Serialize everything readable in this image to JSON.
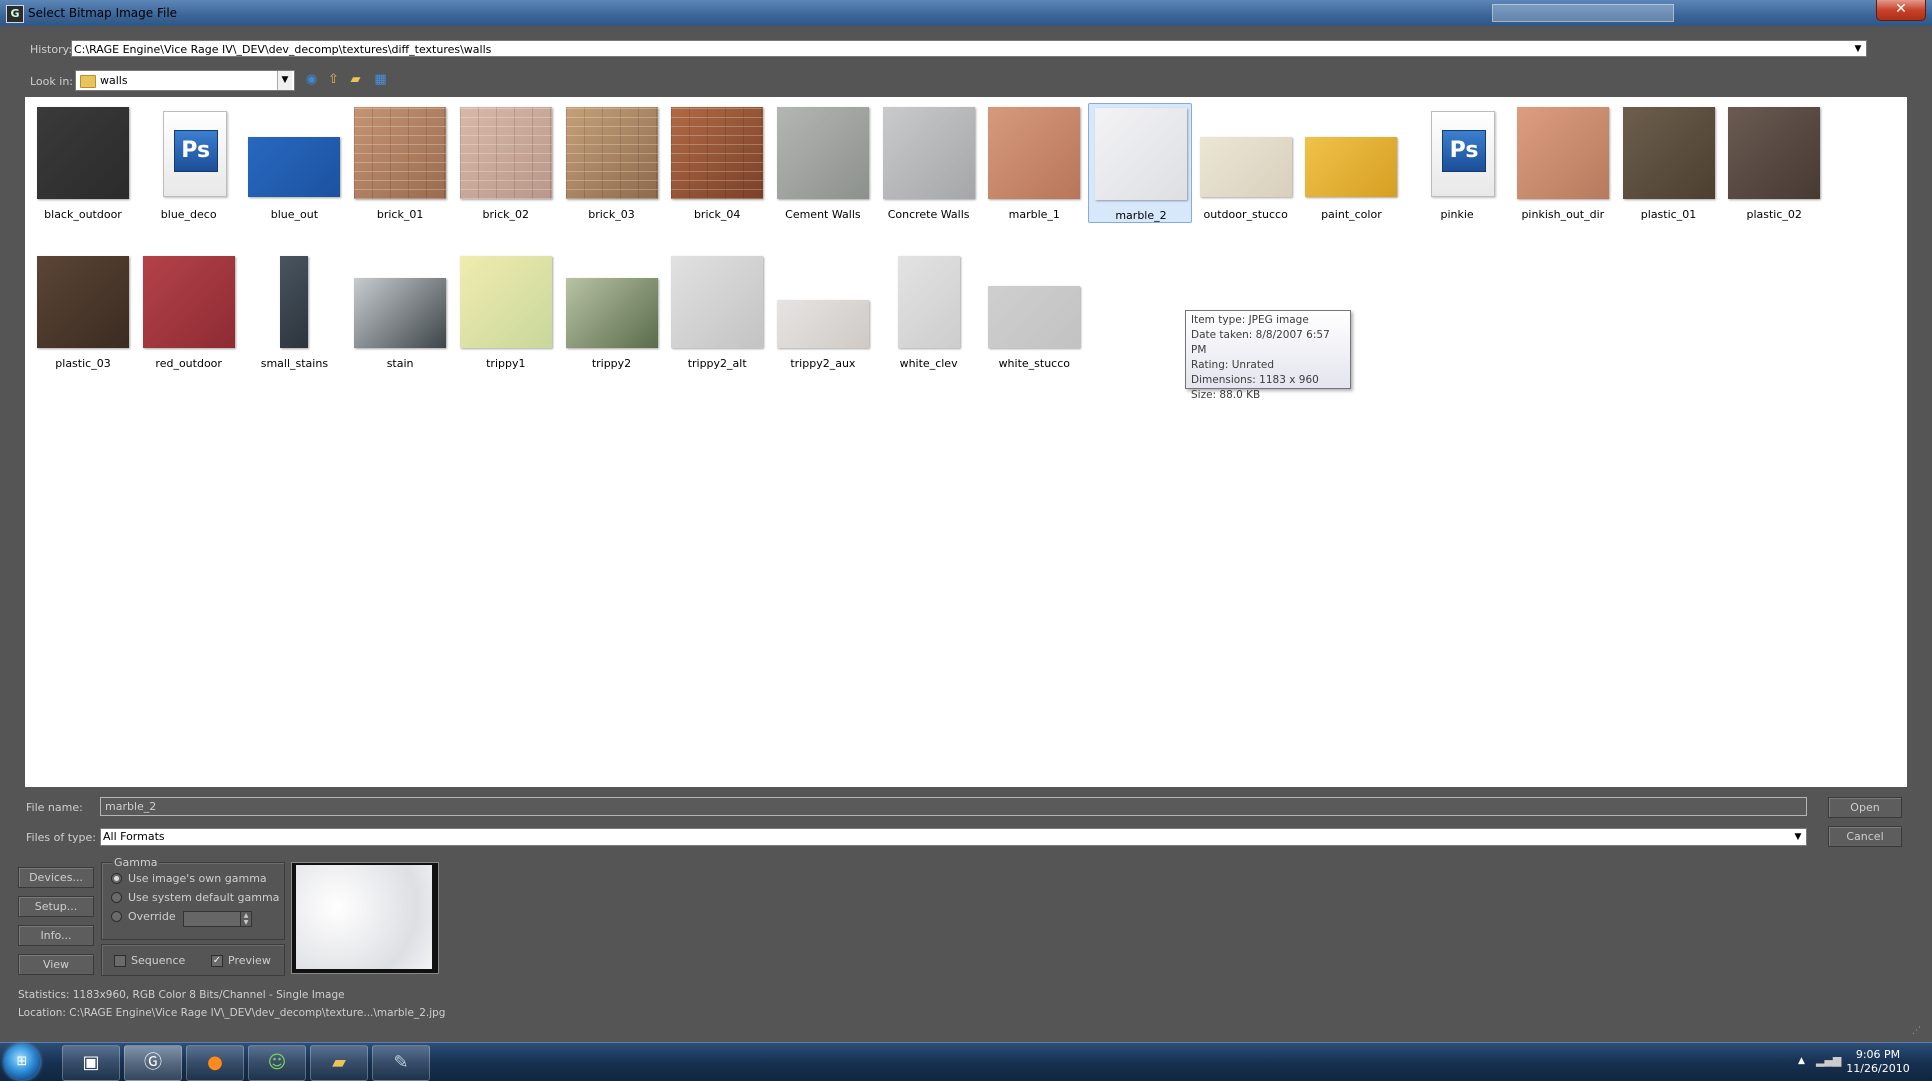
{
  "window": {
    "title": "Select Bitmap Image File"
  },
  "history": {
    "label": "History:",
    "path": "C:\\RAGE Engine\\Vice Rage IV\\_DEV\\dev_decomp\\textures\\diff_textures\\walls"
  },
  "lookin": {
    "label": "Look in:",
    "folder": "walls"
  },
  "files": [
    {
      "name": "black_outdoor",
      "kind": "img",
      "colors": [
        "#3a3a3a",
        "#2b2b2b"
      ]
    },
    {
      "name": "blue_deco",
      "kind": "ps"
    },
    {
      "name": "blue_out",
      "kind": "img",
      "colors": [
        "#2868c0",
        "#1c52a0"
      ]
    },
    {
      "name": "brick_01",
      "kind": "img",
      "colors": [
        "#c49473",
        "#9a6b4f"
      ],
      "pattern": "brick"
    },
    {
      "name": "brick_02",
      "kind": "img",
      "colors": [
        "#d8b9a8",
        "#b9978a"
      ],
      "pattern": "brick"
    },
    {
      "name": "brick_03",
      "kind": "img",
      "colors": [
        "#c5a07a",
        "#8d6a4c"
      ],
      "pattern": "brick"
    },
    {
      "name": "brick_04",
      "kind": "img",
      "colors": [
        "#b06a45",
        "#7a4128"
      ],
      "pattern": "brick"
    },
    {
      "name": "Cement Walls",
      "kind": "img",
      "colors": [
        "#b3b6b2",
        "#8d918c"
      ]
    },
    {
      "name": "Concrete Walls",
      "kind": "img",
      "colors": [
        "#c9cacb",
        "#a5a6a8"
      ]
    },
    {
      "name": "marble_1",
      "kind": "img",
      "colors": [
        "#d69a7b",
        "#b8755a"
      ]
    },
    {
      "name": "marble_2",
      "kind": "img",
      "colors": [
        "#f3f3f5",
        "#dedfe3"
      ]
    },
    {
      "name": "outdoor_stucco",
      "kind": "img",
      "colors": [
        "#ece6d6",
        "#d8d0bb"
      ]
    },
    {
      "name": "paint_color",
      "kind": "img",
      "colors": [
        "#f0c24a",
        "#d69f22"
      ]
    },
    {
      "name": "pinkie",
      "kind": "ps"
    },
    {
      "name": "pinkish_out_dir",
      "kind": "img",
      "colors": [
        "#dc9e7f",
        "#b87a5d"
      ]
    },
    {
      "name": "plastic_01",
      "kind": "img",
      "colors": [
        "#6d5e4c",
        "#4c3f31"
      ]
    },
    {
      "name": "plastic_02",
      "kind": "img",
      "colors": [
        "#6a5a52",
        "#473a33"
      ]
    },
    {
      "name": "plastic_03",
      "kind": "img",
      "colors": [
        "#5b4536",
        "#3b2b21"
      ]
    },
    {
      "name": "red_outdoor",
      "kind": "img",
      "colors": [
        "#b3424a",
        "#8f2b33"
      ]
    },
    {
      "name": "small_stains",
      "kind": "img",
      "colors": [
        "#4a5560",
        "#2c343c"
      ]
    },
    {
      "name": "stain",
      "kind": "img",
      "colors": [
        "#c7ccd0",
        "#3e4549"
      ]
    },
    {
      "name": "trippy1",
      "kind": "img",
      "colors": [
        "#f0ecb0",
        "#c9d79a"
      ]
    },
    {
      "name": "trippy2",
      "kind": "img",
      "colors": [
        "#b9c2a4",
        "#596c4c"
      ]
    },
    {
      "name": "trippy2_alt",
      "kind": "img",
      "colors": [
        "#e1e1e1",
        "#c3c3c3"
      ]
    },
    {
      "name": "trippy2_aux",
      "kind": "img",
      "colors": [
        "#e6e4e2",
        "#cfcac6"
      ]
    },
    {
      "name": "white_clev",
      "kind": "img",
      "colors": [
        "#e3e3e3",
        "#cdcdcd"
      ]
    },
    {
      "name": "white_stucco",
      "kind": "img",
      "colors": [
        "#cfcfcf",
        "#c2c2c2"
      ]
    }
  ],
  "tooltip": {
    "item_type": "Item type: JPEG image",
    "date_taken": "Date taken: 8/8/2007 6:57 PM",
    "rating": "Rating: Unrated",
    "dimensions": "Dimensions: 1183 x 960",
    "size": "Size: 88.0 KB"
  },
  "form": {
    "filename_label": "File name:",
    "filename_value": "marble_2",
    "filetype_label": "Files of type:",
    "filetype_value": "All Formats",
    "open_label": "Open",
    "cancel_label": "Cancel"
  },
  "side_buttons": {
    "devices": "Devices...",
    "setup": "Setup...",
    "info": "Info...",
    "view": "View"
  },
  "gamma": {
    "title": "Gamma",
    "own": "Use image's own gamma",
    "system": "Use system default gamma",
    "override": "Override"
  },
  "options": {
    "sequence": "Sequence",
    "preview": "Preview",
    "preview_checked": true,
    "sequence_checked": false
  },
  "status": {
    "statistics": "Statistics:  1183x960, RGB Color 8 Bits/Channel - Single Image",
    "location": "Location:  C:\\RAGE Engine\\Vice Rage IV\\_DEV\\dev_decomp\\texture...\\marble_2.jpg"
  },
  "taskbar": {
    "time": "9:06 PM",
    "date": "11/26/2010"
  },
  "colors": {
    "dialog_bg": "#555555",
    "selection": "#d8e8fb",
    "titlebar": "#3b6597"
  }
}
